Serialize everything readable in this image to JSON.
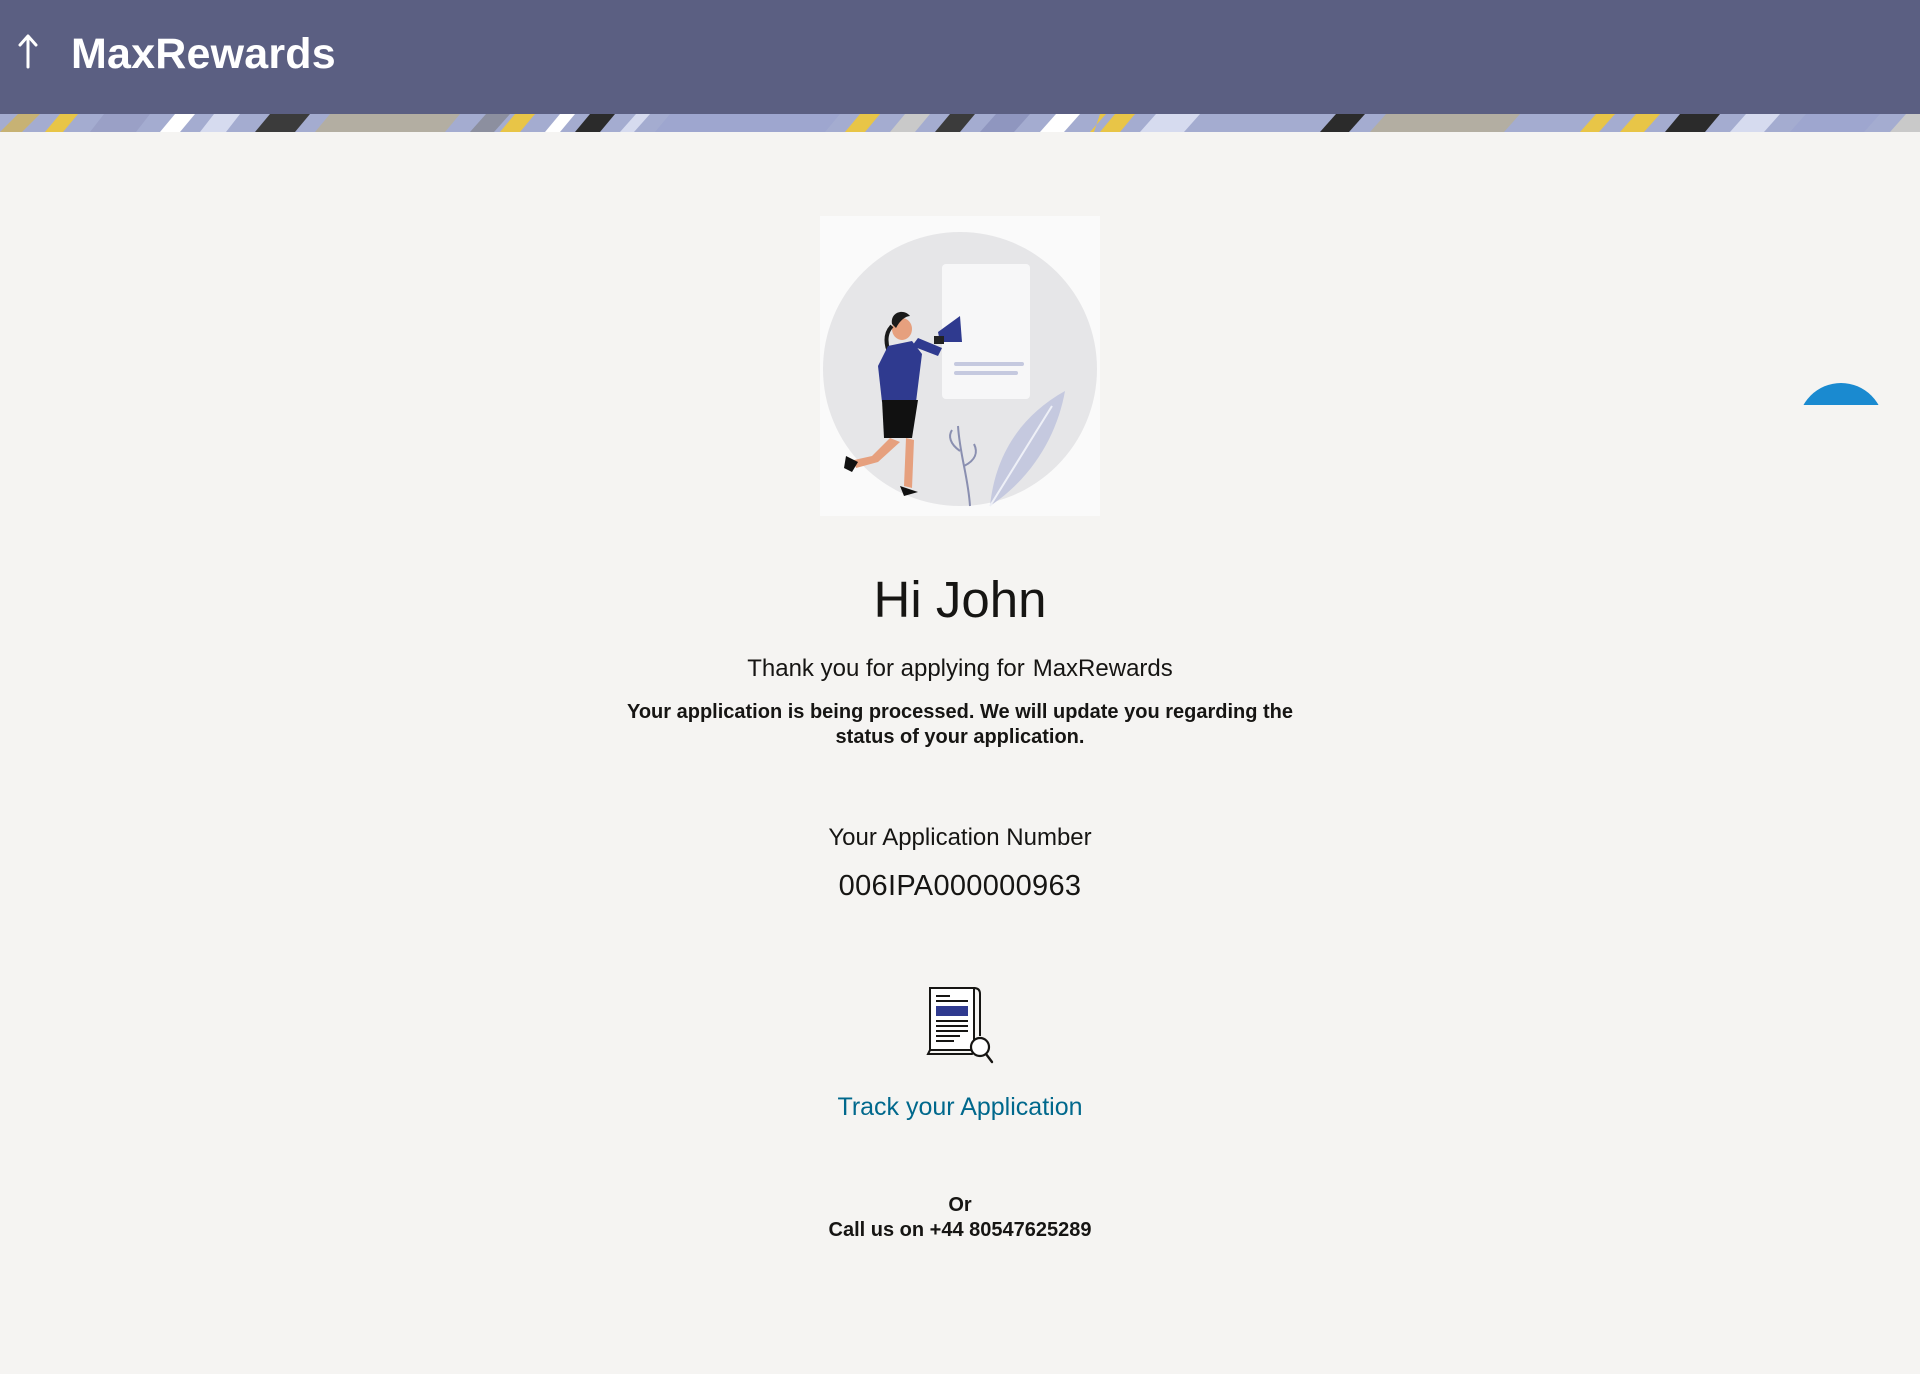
{
  "header": {
    "back_icon": "arrow-up-icon",
    "title": "MaxRewards"
  },
  "colors": {
    "header_bg": "#5b5f82",
    "page_bg": "#f5f4f2",
    "link": "#00688c",
    "fab": "#1a8ad0",
    "illustration_accent": "#2f3a8f"
  },
  "confirmation": {
    "greeting": "Hi John",
    "thanks_prefix": "Thank you for applying for",
    "product_name": "MaxRewards",
    "processing_message": "Your application is being processed. We will update you regarding the status of your application.",
    "application_number_label": "Your Application Number",
    "application_number": "006IPA000000963"
  },
  "track": {
    "icon": "document-search-icon",
    "link_label": "Track your Application"
  },
  "contact": {
    "or_label": "Or",
    "call_text": "Call us on +44 80547625289"
  },
  "illustration": {
    "icon": "woman-megaphone-illustration"
  },
  "fab": {
    "icon": "chat-bubble-icon"
  }
}
